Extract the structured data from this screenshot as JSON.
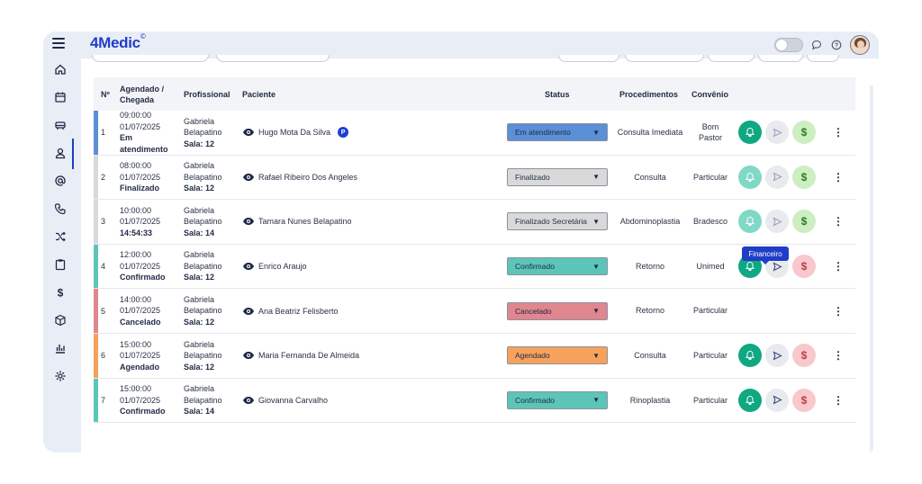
{
  "app": {
    "logo": "4Medic",
    "logo_mark": "©"
  },
  "colors": {
    "accent": "#1f3ec7",
    "confirmado": "#5cc5b8",
    "finalizado": "#d9d9d9",
    "cancelado": "#e0868e",
    "agendado": "#f7a25c",
    "em_atendimento": "#5b8fd6"
  },
  "sidebar": {
    "items": [
      "home-icon",
      "calendar-icon",
      "car-icon",
      "user-icon",
      "at-icon",
      "phone-icon",
      "shuffle-icon",
      "clipboard-icon",
      "dollar-icon",
      "box-icon",
      "chart-icon",
      "gear-icon"
    ]
  },
  "table": {
    "headers": {
      "num": "Nº",
      "sched": "Agendado / Chegada",
      "prof": "Profissional",
      "patient": "Paciente",
      "status": "Status",
      "proc": "Procedimentos",
      "conv": "Convênio"
    },
    "rows": [
      {
        "num": "1",
        "time": "09:00:00",
        "date": "01/07/2025",
        "arrival": "Em atendimento",
        "prof1": "Gabriela",
        "prof2": "Belapatino",
        "room": "Sala: 12",
        "patient": "Hugo Mota Da Silva",
        "badge": "P",
        "status": "Em atendimento",
        "proc": "Consulta Imediata",
        "conv": "Bom Pastor"
      },
      {
        "num": "2",
        "time": "08:00:00",
        "date": "01/07/2025",
        "arrival": "Finalizado",
        "prof1": "Gabriela",
        "prof2": "Belapatino",
        "room": "Sala: 12",
        "patient": "Rafael Ribeiro Dos Angeles",
        "status": "Finalizado",
        "proc": "Consulta",
        "conv": "Particular"
      },
      {
        "num": "3",
        "time": "10:00:00",
        "date": "01/07/2025",
        "arrival": "14:54:33",
        "prof1": "Gabriela",
        "prof2": "Belapatino",
        "room": "Sala: 14",
        "patient": "Tamara Nunes Belapatino",
        "status": "Finalizado Secretária",
        "proc": "Abdominoplastia",
        "conv": "Bradesco"
      },
      {
        "num": "4",
        "time": "12:00:00",
        "date": "01/07/2025",
        "arrival": "Confirmado",
        "prof1": "Gabriela",
        "prof2": "Belapatino",
        "room": "Sala: 12",
        "patient": "Enrico Araujo",
        "status": "Confirmado",
        "proc": "Retorno",
        "conv": "Unimed"
      },
      {
        "num": "5",
        "time": "14:00:00",
        "date": "01/07/2025",
        "arrival": "Cancelado",
        "prof1": "Gabriela",
        "prof2": "Belapatino",
        "room": "Sala: 12",
        "patient": "Ana Beatriz Felisberto",
        "status": "Cancelado",
        "proc": "Retorno",
        "conv": "Particular"
      },
      {
        "num": "6",
        "time": "15:00:00",
        "date": "01/07/2025",
        "arrival": "Agendado",
        "prof1": "Gabriela",
        "prof2": "Belapatino",
        "room": "Sala: 12",
        "patient": "Maria Fernanda De Almeida",
        "status": "Agendado",
        "proc": "Consulta",
        "conv": "Particular"
      },
      {
        "num": "7",
        "time": "15:00:00",
        "date": "01/07/2025",
        "arrival": "Confirmado",
        "prof1": "Gabriela",
        "prof2": "Belapatino",
        "room": "Sala: 14",
        "patient": "Giovanna Carvalho",
        "status": "Confirmado",
        "proc": "Rinoplastia",
        "conv": "Particular"
      }
    ]
  },
  "tooltip": {
    "label": "Financeiro"
  }
}
